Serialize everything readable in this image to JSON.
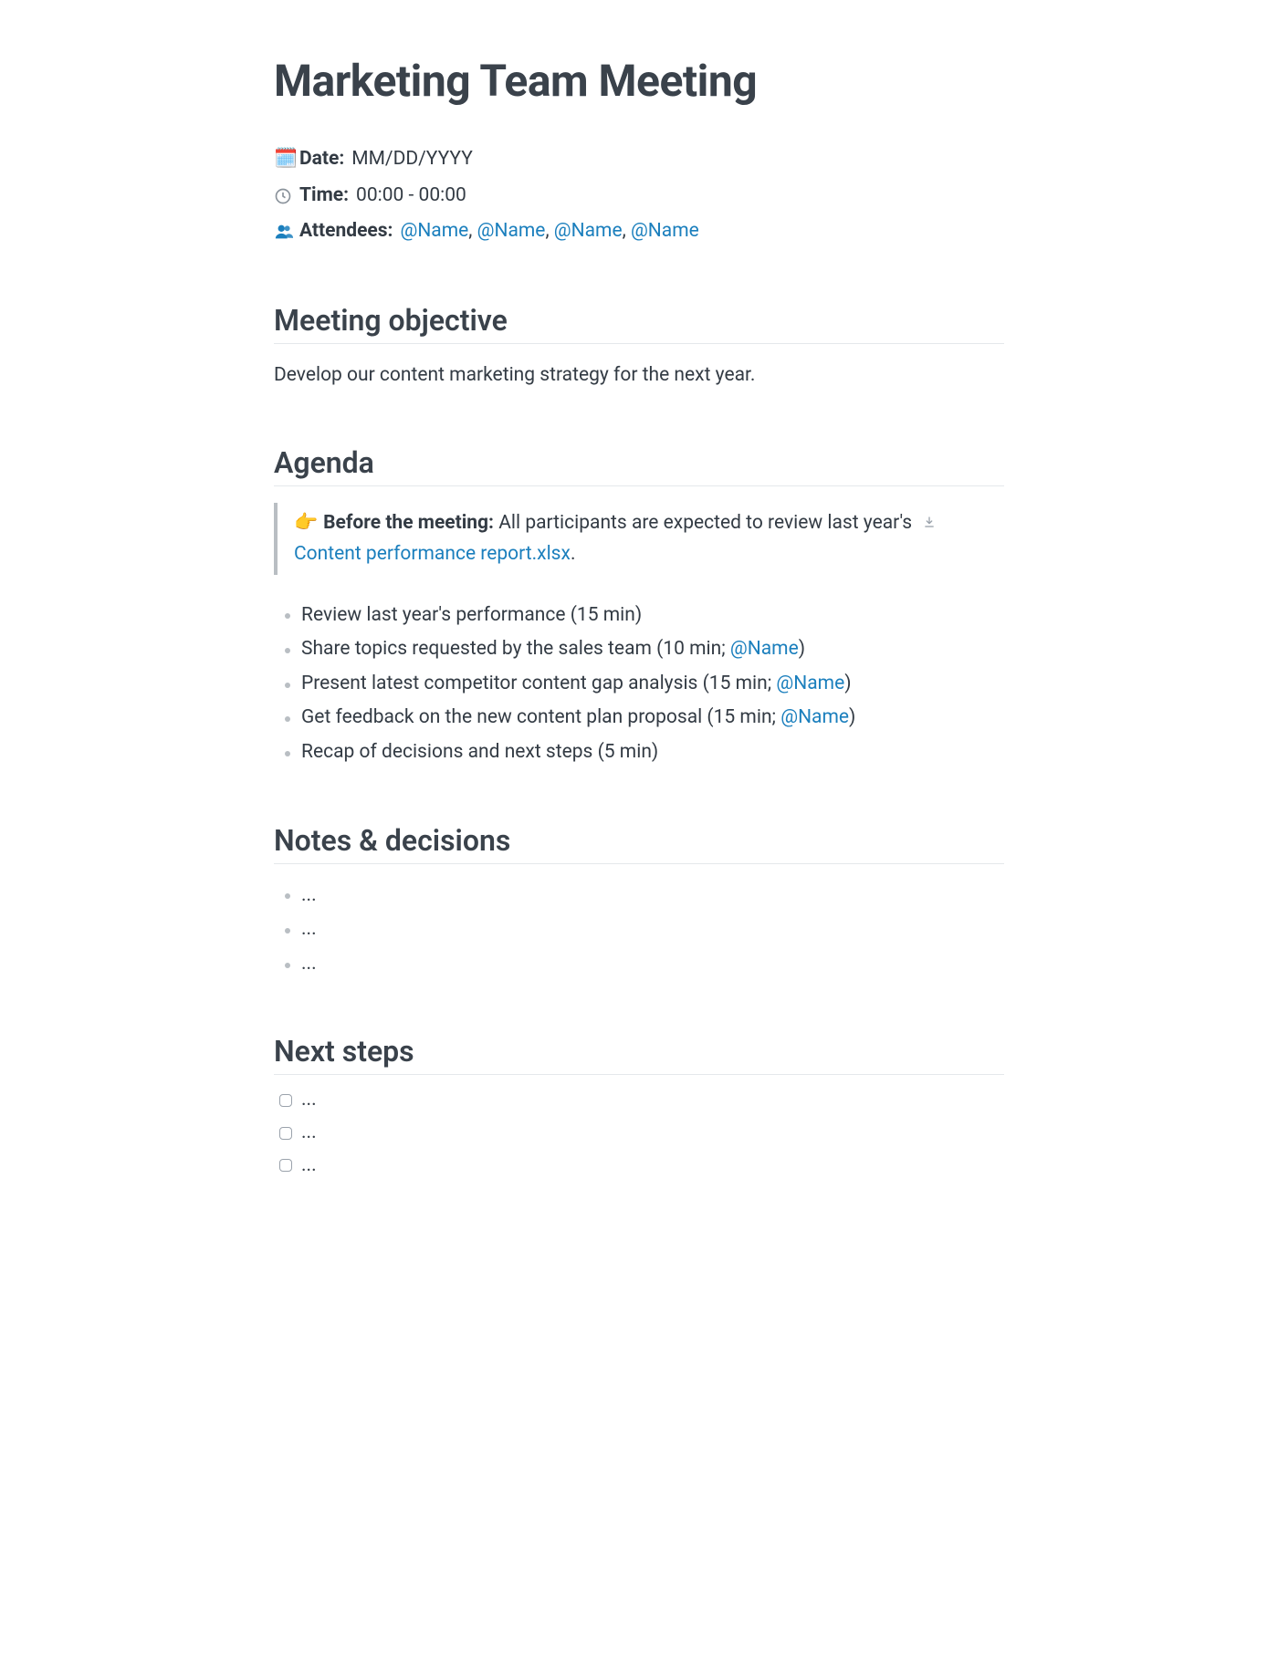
{
  "title": "Marketing Team Meeting",
  "meta": {
    "date_icon": "🗓️",
    "date_label": "Date:",
    "date_value": "MM/DD/YYYY",
    "time_label": "Time:",
    "time_value": "00:00 - 00:00",
    "attendees_icon": "👥",
    "attendees_label": "Attendees:",
    "attendees": [
      "@Name",
      "@Name",
      "@Name",
      "@Name"
    ]
  },
  "sections": {
    "objective": {
      "heading": "Meeting objective",
      "body": "Develop our content marketing strategy for the next year."
    },
    "agenda": {
      "heading": "Agenda",
      "callout_emoji": "👉",
      "callout_label": "Before the meeting:",
      "callout_text_before": " All participants are expected to review last year's ",
      "callout_file": "Content performance report.xlsx",
      "callout_text_after": ".",
      "items": [
        {
          "text": "Review last year's performance (15 min)",
          "mention": null,
          "suffix": ""
        },
        {
          "text": "Share topics requested by the sales team (10 min; ",
          "mention": "@Name",
          "suffix": ")"
        },
        {
          "text": "Present latest competitor content gap analysis (15 min; ",
          "mention": "@Name",
          "suffix": ")"
        },
        {
          "text": "Get feedback on the new content plan proposal (15 min; ",
          "mention": "@Name",
          "suffix": ")"
        },
        {
          "text": "Recap of decisions and next steps (5 min)",
          "mention": null,
          "suffix": ""
        }
      ]
    },
    "notes": {
      "heading": "Notes & decisions",
      "items": [
        "...",
        "...",
        "..."
      ]
    },
    "next_steps": {
      "heading": "Next steps",
      "items": [
        "...",
        "...",
        "..."
      ]
    }
  }
}
